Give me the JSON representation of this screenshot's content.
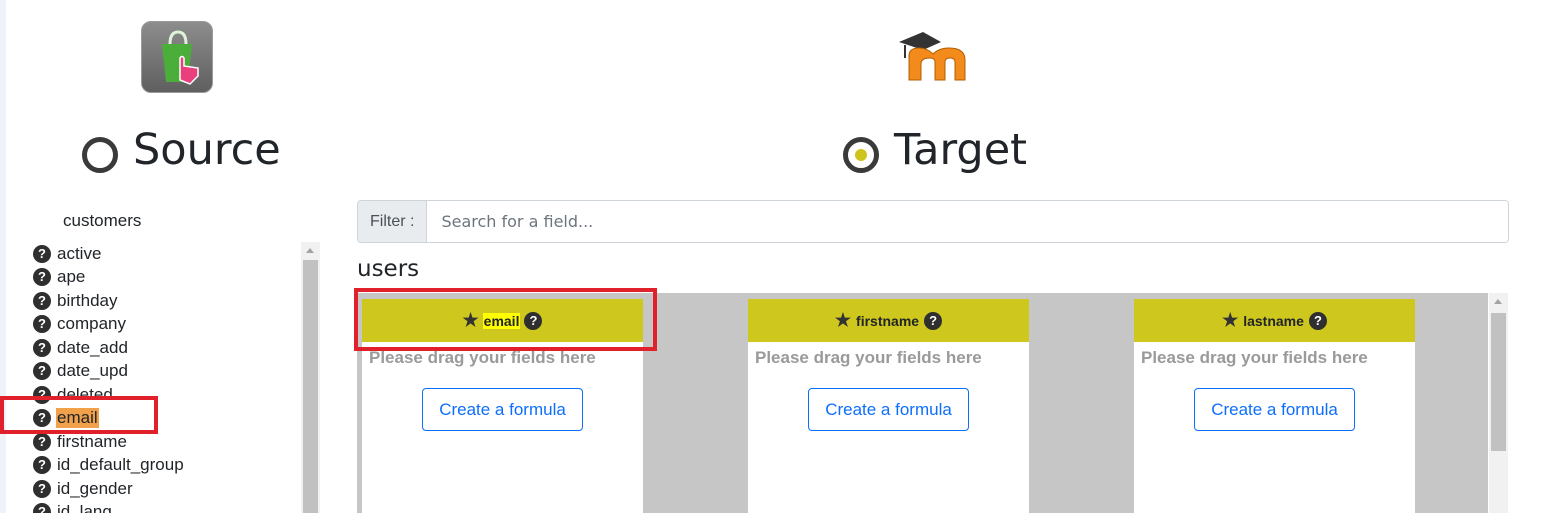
{
  "source": {
    "heading": "Source",
    "module": "customers",
    "fields": [
      {
        "label": "active",
        "highlighted": false
      },
      {
        "label": "ape",
        "highlighted": false
      },
      {
        "label": "birthday",
        "highlighted": false
      },
      {
        "label": "company",
        "highlighted": false
      },
      {
        "label": "date_add",
        "highlighted": false
      },
      {
        "label": "date_upd",
        "highlighted": false
      },
      {
        "label": "deleted",
        "highlighted": false
      },
      {
        "label": "email",
        "highlighted": true
      },
      {
        "label": "firstname",
        "highlighted": false
      },
      {
        "label": "id_default_group",
        "highlighted": false
      },
      {
        "label": "id_gender",
        "highlighted": false
      },
      {
        "label": "id_lang",
        "highlighted": false
      }
    ]
  },
  "target": {
    "heading": "Target",
    "filter_label": "Filter :",
    "filter_placeholder": "Search for a field...",
    "module": "users",
    "fields": [
      {
        "name": "email",
        "drag_text": "Please drag your fields here",
        "button": "Create a formula"
      },
      {
        "name": "firstname",
        "drag_text": "Please drag your fields here",
        "button": "Create a formula"
      },
      {
        "name": "lastname",
        "drag_text": "Please drag your fields here",
        "button": "Create a formula"
      }
    ]
  },
  "icons": {
    "help": "?",
    "star": "★"
  },
  "colors": {
    "card_header": "#cec71d",
    "source_highlight": "#f0a14a",
    "target_highlight": "#ffff00",
    "annotation_red": "#e0202a",
    "button_blue": "#0d6efd"
  }
}
